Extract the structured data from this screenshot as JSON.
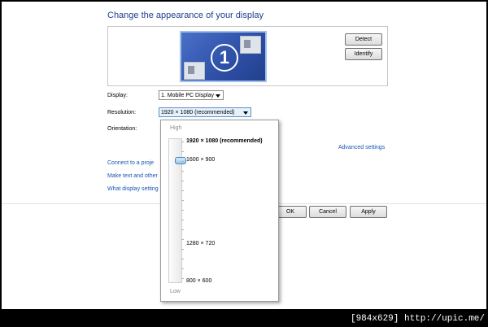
{
  "heading": "Change the appearance of your display",
  "preview": {
    "monitor_number": "1",
    "detect_label": "Detect",
    "identify_label": "Identify"
  },
  "display": {
    "label": "Display:",
    "value": "1. Mobile PC Display"
  },
  "resolution": {
    "label": "Resolution:",
    "value": "1920 × 1080 (recommended)"
  },
  "orientation": {
    "label": "Orientation:"
  },
  "links": {
    "advanced": "Advanced settings",
    "connect": "Connect to a proje",
    "make_text": "Make text and other",
    "what_display": "What display setting"
  },
  "footer": {
    "ok": "OK",
    "cancel": "Cancel",
    "apply": "Apply"
  },
  "popup": {
    "high_label": "High",
    "low_label": "Low",
    "options": [
      "1920 × 1080 (recommended)",
      "1600 × 900",
      "1280 × 720",
      "800 × 600"
    ],
    "selected_index": 0
  },
  "watermark": "[984x629] http://upic.me/"
}
